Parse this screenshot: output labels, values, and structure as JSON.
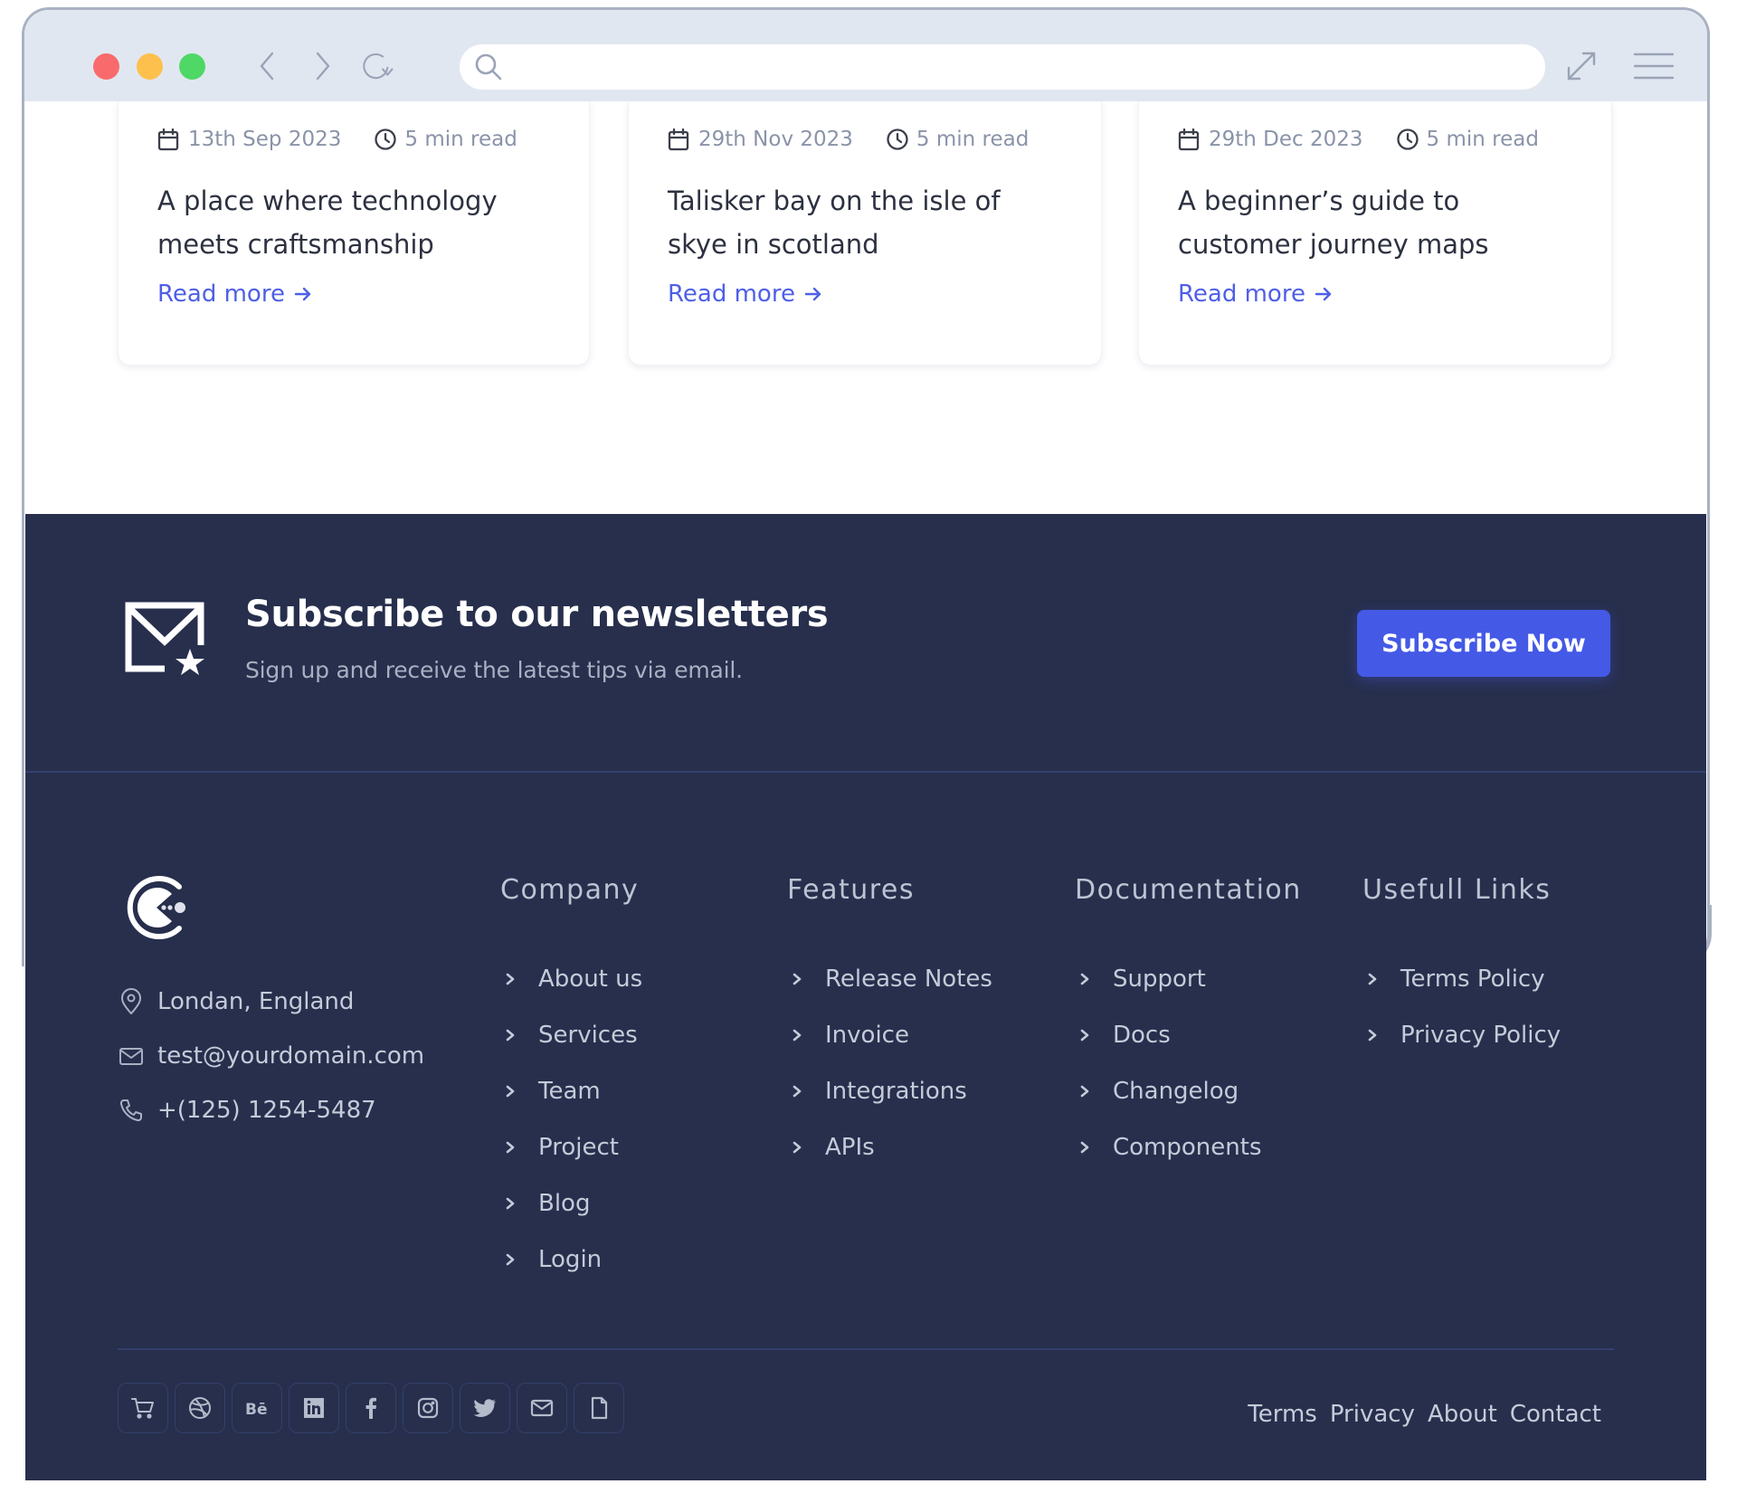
{
  "browser": {
    "url_value": "",
    "window_controls": [
      "close",
      "minimize",
      "maximize"
    ],
    "nav_icons": [
      "back-arrow-icon",
      "forward-arrow-icon",
      "reload-icon",
      "search-icon",
      "expand-icon",
      "menu-icon"
    ],
    "control_colors": {
      "close": "#f96a6c",
      "minimize": "#fdc04d",
      "maximize": "#4fd866"
    }
  },
  "blog_cards": [
    {
      "date": "13th Sep 2023",
      "read_time": "5 min read",
      "title": "A place where technology meets craftsmanship",
      "link_label": "Read more"
    },
    {
      "date": "29th Nov 2023",
      "read_time": "5 min read",
      "title": "Talisker bay on the isle of skye in scotland",
      "link_label": "Read more"
    },
    {
      "date": "29th Dec 2023",
      "read_time": "5 min read",
      "title": "A beginner’s guide to customer journey maps",
      "link_label": "Read more"
    }
  ],
  "newsletter": {
    "icon": "mail-star-icon",
    "title": "Subscribe to our newsletters",
    "subtitle": "Sign up and receive the latest tips via email.",
    "button_label": "Subscribe Now"
  },
  "footer": {
    "contact": {
      "location": "Londan, England",
      "email": "test@yourdomain.com",
      "phone": "+(125) 1254-5487"
    },
    "columns": [
      {
        "heading": "Company",
        "items": [
          "About us",
          "Services",
          "Team",
          "Project",
          "Blog",
          "Login"
        ]
      },
      {
        "heading": "Features",
        "items": [
          "Release Notes",
          "Invoice",
          "Integrations",
          "APIs"
        ]
      },
      {
        "heading": "Documentation",
        "items": [
          "Support",
          "Docs",
          "Changelog",
          "Components"
        ]
      },
      {
        "heading": "Usefull Links",
        "items": [
          "Terms Policy",
          "Privacy Policy"
        ]
      }
    ],
    "social_icons": [
      "cart-icon",
      "dribbble-icon",
      "behance-icon",
      "linkedin-icon",
      "facebook-icon",
      "instagram-icon",
      "twitter-icon",
      "mail-icon",
      "file-icon"
    ],
    "bottom_links": [
      "Terms",
      "Privacy",
      "About",
      "Contact"
    ]
  },
  "colors": {
    "accent": "#4459e6",
    "link": "#4e5fe6",
    "footer_bg": "#272f4d",
    "topbar_bg": "#e1e7f1"
  }
}
